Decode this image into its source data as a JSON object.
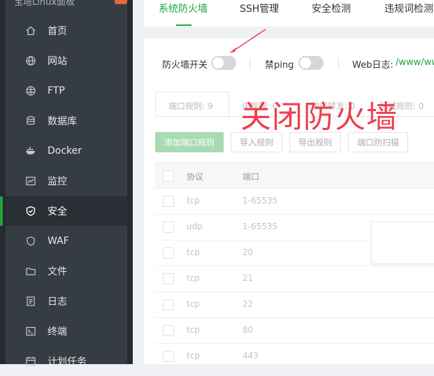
{
  "sidebar": {
    "title": "宝塔Linux面板",
    "items": [
      {
        "label": "首页",
        "icon": "home-icon"
      },
      {
        "label": "网站",
        "icon": "globe-icon"
      },
      {
        "label": "FTP",
        "icon": "ftp-globe-icon"
      },
      {
        "label": "数据库",
        "icon": "database-icon"
      },
      {
        "label": "Docker",
        "icon": "docker-icon"
      },
      {
        "label": "监控",
        "icon": "monitor-icon"
      },
      {
        "label": "安全",
        "icon": "shield-icon",
        "active": true
      },
      {
        "label": "WAF",
        "icon": "waf-icon"
      },
      {
        "label": "文件",
        "icon": "folder-icon"
      },
      {
        "label": "日志",
        "icon": "log-icon"
      },
      {
        "label": "终端",
        "icon": "terminal-icon"
      },
      {
        "label": "计划任务",
        "icon": "calendar-icon"
      }
    ]
  },
  "tabs": [
    "系统防火墙",
    "SSH管理",
    "安全检测",
    "违规词检测"
  ],
  "active_tab": 0,
  "controls": {
    "firewall_switch_label": "防火墙开关",
    "firewall_switch_on": false,
    "ping_label": "禁ping",
    "ping_on": false,
    "weblog_label": "Web日志:",
    "weblog_path": "/www/wwwl"
  },
  "subtabs": [
    "端口规则: 9",
    "IP规则: 0",
    "端口转发: 0",
    "区域规则: 0"
  ],
  "buttons": {
    "add_port_rule": "添加端口规则",
    "import_rules": "导入规则",
    "export_rules": "导出规则",
    "port_scan_protect": "端口防扫描"
  },
  "table": {
    "columns": [
      "协议",
      "端口"
    ],
    "rows": [
      [
        "tcp",
        "1-65535"
      ],
      [
        "udp",
        "1-65535"
      ],
      [
        "tcp",
        "20"
      ],
      [
        "tcp",
        "21"
      ],
      [
        "tcp",
        "22"
      ],
      [
        "tcp",
        "80"
      ],
      [
        "tcp",
        "443"
      ]
    ]
  },
  "annotation": "关闭防火墙",
  "colors": {
    "accent": "#20a53a",
    "sidebar_bg": "#363c43",
    "annotation": "#ee3f4d"
  }
}
